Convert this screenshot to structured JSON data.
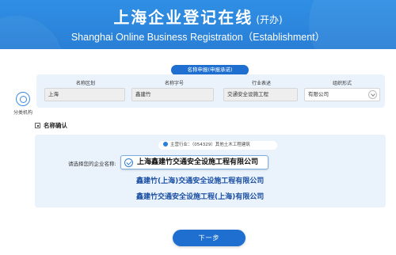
{
  "header": {
    "title_cn": "上海企业登记在线",
    "title_cn_sub": "(开办)",
    "title_en": "Shanghai Online Business Registration（Establishment）"
  },
  "side_tool": {
    "label": "分类机构",
    "icon": "target-icon"
  },
  "apply": {
    "section_label": "名称申报(申报承诺)",
    "columns": [
      {
        "label": "名称区划",
        "value": "上海"
      },
      {
        "label": "名称字号",
        "value": "鑫建竹"
      },
      {
        "label": "行业表述",
        "value": "交通安全设施工程"
      },
      {
        "label": "组织形式",
        "value": "有限公司"
      }
    ]
  },
  "confirm": {
    "heading": "名称确认",
    "industry": "主营行业：（054329）其他土木工程建筑",
    "select_label": "请选择您的企业名称:",
    "options": [
      "上海鑫建竹交通安全设施工程有限公司",
      "鑫建竹(上海)交通安全设施工程有限公司",
      "鑫建竹交通安全设施工程(上海)有限公司"
    ]
  },
  "next_button": "下一步",
  "colors": {
    "brand": "#2a7fd6",
    "button": "#1e6fd0",
    "panel": "#eaf3fc"
  }
}
